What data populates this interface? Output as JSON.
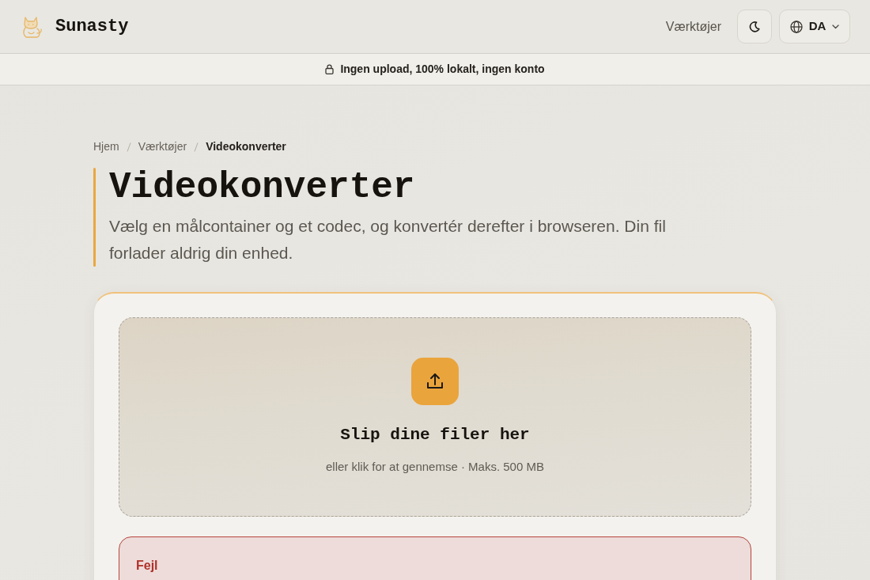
{
  "header": {
    "brand": "Sunasty",
    "nav_link": "Værktøjer",
    "language_button": "DA"
  },
  "banner": {
    "text": "Ingen upload, 100% lokalt, ingen konto"
  },
  "breadcrumb": [
    {
      "label": "Hjem",
      "current": false
    },
    {
      "label": "Værktøjer",
      "current": false
    },
    {
      "label": "Videokonverter",
      "current": true
    }
  ],
  "page": {
    "title": "Videokonverter",
    "lead": "Vælg en målcontainer og et codec, og konvertér derefter i browseren. Din fil forlader aldrig din enhed."
  },
  "dropzone": {
    "title": "Slip dine filer her",
    "hint": "eller klik for at gennemse · Maks. 500 MB"
  },
  "error": {
    "title": "Fejl"
  }
}
